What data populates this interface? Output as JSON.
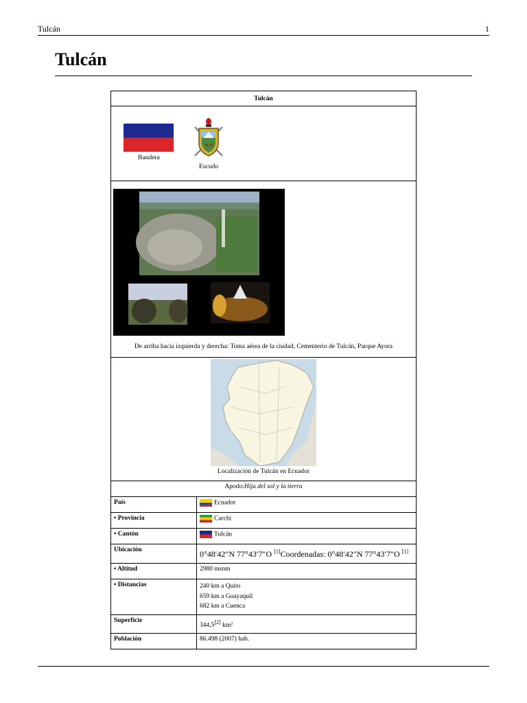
{
  "header": {
    "running_title": "Tulcán",
    "page_number": "1"
  },
  "page_title": "Tulcán",
  "infobox": {
    "title": "Tulcán",
    "flag_caption": "Bandera",
    "coat_caption": "Escudo",
    "photos_caption": "De arriba hacia izquierda y derecha: Toma aérea de la ciudad, Cementerio de Tulcán, Parque Ayora",
    "map_caption": "Localización de Tulcán en Ecuador",
    "nickname_label": "Apodo:",
    "nickname_value": "Hija del sol y la tierra",
    "rows": {
      "pais": {
        "label": "País",
        "value": "Ecuador"
      },
      "provincia": {
        "label": "• Provincia",
        "value": "Carchi"
      },
      "canton": {
        "label": "• Cantón",
        "value": "Tulcán"
      },
      "ubicacion": {
        "label": "Ubicación",
        "coord1": "0°48′42″N 77°43′7″O ",
        "ref1": "[1]",
        "coord_prefix": "Coordenadas: ",
        "coord2": "0°48′42″N 77°43′7″O ",
        "ref2": "[1]"
      },
      "altitud": {
        "label": "• Altitud",
        "value": "2980 msnm"
      },
      "distancias": {
        "label": "• Distancias",
        "lines": [
          "240 km a Quito",
          "659 km a Guayaquil",
          "682 km a Cuenca"
        ]
      },
      "superficie": {
        "label": "Superficie",
        "value": "344,5",
        "ref": "[2]",
        "unit": " km²"
      },
      "poblacion": {
        "label": "Población",
        "value": "86.498 (2007) hab."
      }
    }
  }
}
